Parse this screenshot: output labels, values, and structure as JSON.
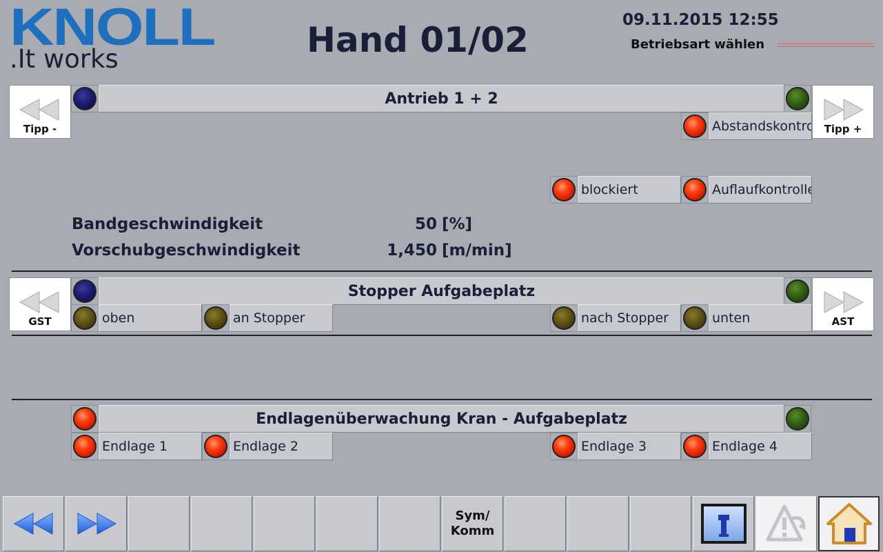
{
  "header": {
    "logo_brand": "KNOLL",
    "logo_tagline": ".It works",
    "title": "Hand 01/02",
    "datetime": "09.11.2015 12:55",
    "mode_label": "Betriebsart wählen"
  },
  "drive": {
    "title": "Antrieb 1 + 2",
    "left_button": "Tipp -",
    "right_button": "Tipp +",
    "abstand_label": "Abstandskontrolle",
    "blockiert_label": "blockiert",
    "auflauf_label": "Auflaufkontrolle"
  },
  "params": [
    {
      "label": "Bandgeschwindigkeit",
      "value": "50",
      "unit": "[%]"
    },
    {
      "label": "Vorschubgeschwindigkeit",
      "value": "1,450",
      "unit": "[m/min]"
    }
  ],
  "stopper": {
    "title": "Stopper Aufgabeplatz",
    "left_button": "GST",
    "right_button": "AST",
    "labels": [
      "oben",
      "an Stopper",
      "nach Stopper",
      "unten"
    ]
  },
  "endlage": {
    "title": "Endlagenüberwachung Kran - Aufgabeplatz",
    "labels": [
      "Endlage 1",
      "Endlage 2",
      "Endlage 3",
      "Endlage 4"
    ]
  },
  "toolbar": {
    "sym_komm": "Sym/\nKomm"
  },
  "colors": {
    "background": "#a9abb3",
    "lamp_red": "#ff3d10",
    "lamp_navy": "#1a1a70",
    "lamp_green": "#2f5a12",
    "lamp_olive": "#5a4d12",
    "logo_blue": "#1f6fbf"
  }
}
